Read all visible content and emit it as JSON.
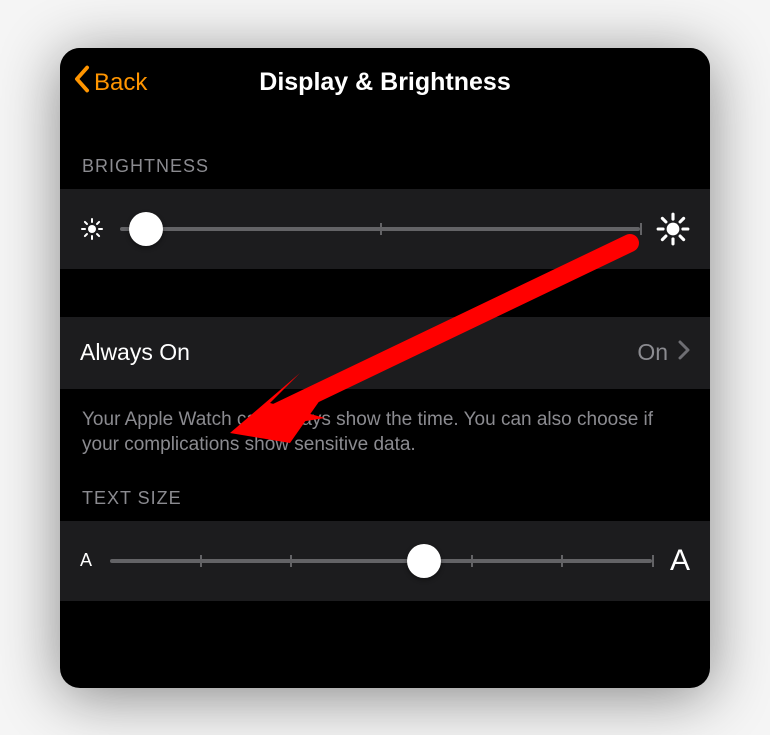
{
  "nav": {
    "back_label": "Back",
    "title": "Display & Brightness"
  },
  "brightness": {
    "header": "BRIGHTNESS",
    "min_icon": "sun-small-icon",
    "max_icon": "sun-large-icon",
    "value_percent": 5
  },
  "always_on": {
    "label": "Always On",
    "value": "On",
    "footer": "Your Apple Watch can always show the time. You can also choose if your complications show sensitive data."
  },
  "text_size": {
    "header": "TEXT SIZE",
    "min_label": "A",
    "max_label": "A",
    "value_percent": 58
  },
  "colors": {
    "accent": "#ff9500",
    "arrow": "#ff0000"
  }
}
